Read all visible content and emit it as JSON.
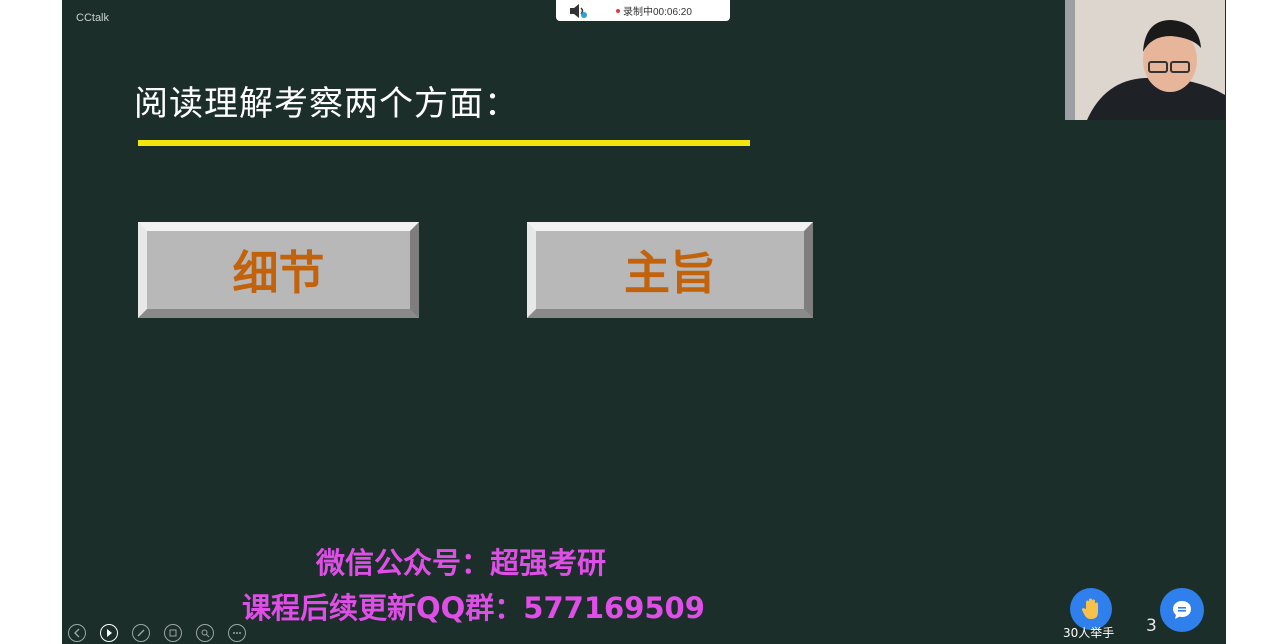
{
  "app": {
    "name": "CCtalk"
  },
  "recording": {
    "status_text": "录制中00:06:20",
    "indicator_color": "#e23a3a"
  },
  "slide": {
    "heading": "阅读理解考察两个方面：",
    "underline_color": "#f3e60f",
    "buttons": [
      {
        "label": "细节"
      },
      {
        "label": "主旨"
      }
    ],
    "promo": {
      "line1": "微信公众号：超强考研",
      "line2": "课程后续更新QQ群：577169509"
    },
    "page_number": "3",
    "background_color": "#1c2e2a",
    "label_color": "#c2630c",
    "promo_color": "#e04ee8"
  },
  "toolbar": {
    "tools": [
      "prev-icon",
      "next-icon",
      "pen-icon",
      "layers-icon",
      "zoom-icon",
      "more-icon"
    ]
  },
  "hand_raise": {
    "label": "30人举手"
  },
  "chat": {
    "icon": "chat-icon"
  }
}
